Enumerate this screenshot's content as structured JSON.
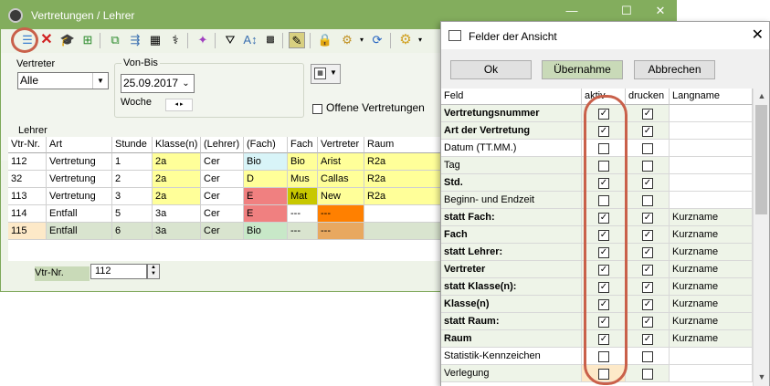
{
  "main_window": {
    "title": "Vertretungen / Lehrer",
    "controls": {
      "minimize": "—",
      "maximize": "☐",
      "close": "✕"
    }
  },
  "toolbar": {
    "icons": [
      "list-view-icon",
      "delete-x-icon",
      "graduation-cap-icon",
      "add-record-icon",
      "copy-doc-icon",
      "export-doc-icon",
      "calculator-icon",
      "stethoscope-icon",
      "magic-wand-icon",
      "filter-icon",
      "sort-az-icon",
      "grid-select-icon",
      "edit-notepad-icon",
      "lock-icon",
      "settings-doc-icon",
      "refresh-icon",
      "gear-icon"
    ]
  },
  "filters": {
    "vertreter_label": "Vertreter",
    "vertreter_value": "Alle",
    "vonbis_label": "Von-Bis",
    "date_value": "25.09.2017",
    "woche_label": "Woche",
    "offene_label": "Offene Vertretungen",
    "lehrer_label": "Lehrer"
  },
  "table": {
    "columns": [
      "Vtr-Nr.",
      "Art",
      "Stunde",
      "Klasse(n)",
      "(Lehrer)",
      "(Fach)",
      "Fach",
      "Vertreter",
      "Raum"
    ],
    "rows": [
      {
        "nr": "112",
        "art": "Vertretung",
        "stunde": "1",
        "klasse": "2a",
        "lehrer": "Cer",
        "sfach": "Bio",
        "fach": "Bio",
        "vertreter": "Arist",
        "raum": "R2a"
      },
      {
        "nr": "32",
        "art": "Vertretung",
        "stunde": "2",
        "klasse": "2a",
        "lehrer": "Cer",
        "sfach": "D",
        "fach": "Mus",
        "vertreter": "Callas",
        "raum": "R2a"
      },
      {
        "nr": "113",
        "art": "Vertretung",
        "stunde": "3",
        "klasse": "2a",
        "lehrer": "Cer",
        "sfach": "E",
        "fach": "Mat",
        "vertreter": "New",
        "raum": "R2a"
      },
      {
        "nr": "114",
        "art": "Entfall",
        "stunde": "5",
        "klasse": "3a",
        "lehrer": "Cer",
        "sfach": "E",
        "fach": "---",
        "vertreter": "---",
        "raum": ""
      },
      {
        "nr": "115",
        "art": "Entfall",
        "stunde": "6",
        "klasse": "3a",
        "lehrer": "Cer",
        "sfach": "Bio",
        "fach": "---",
        "vertreter": "---",
        "raum": ""
      }
    ]
  },
  "bottom": {
    "vtr_label": "Vtr-Nr.",
    "vtr_value": "112"
  },
  "dialog": {
    "title": "Felder der Ansicht",
    "ok_label": "Ok",
    "uebernahme_label": "Übernahme",
    "abbrechen_label": "Abbrechen",
    "columns": [
      "Feld",
      "aktiv",
      "drucken",
      "Langname"
    ],
    "rows": [
      {
        "feld": "Vertretungsnummer",
        "bold": true,
        "aktiv": true,
        "drucken": true,
        "langname": ""
      },
      {
        "feld": "Art der Vertretung",
        "bold": true,
        "aktiv": true,
        "drucken": true,
        "langname": ""
      },
      {
        "feld": "Datum (TT.MM.)",
        "bold": false,
        "aktiv": false,
        "drucken": false,
        "langname": ""
      },
      {
        "feld": "Tag",
        "bold": false,
        "aktiv": false,
        "drucken": false,
        "langname": ""
      },
      {
        "feld": "Std.",
        "bold": true,
        "aktiv": true,
        "drucken": true,
        "langname": ""
      },
      {
        "feld": "Beginn- und Endzeit",
        "bold": false,
        "aktiv": false,
        "drucken": false,
        "langname": ""
      },
      {
        "feld": "statt Fach:",
        "bold": true,
        "aktiv": true,
        "drucken": true,
        "langname": "Kurzname"
      },
      {
        "feld": "Fach",
        "bold": true,
        "aktiv": true,
        "drucken": true,
        "langname": "Kurzname"
      },
      {
        "feld": "statt Lehrer:",
        "bold": true,
        "aktiv": true,
        "drucken": true,
        "langname": "Kurzname"
      },
      {
        "feld": "Vertreter",
        "bold": true,
        "aktiv": true,
        "drucken": true,
        "langname": "Kurzname"
      },
      {
        "feld": "statt Klasse(n):",
        "bold": true,
        "aktiv": true,
        "drucken": true,
        "langname": "Kurzname"
      },
      {
        "feld": "Klasse(n)",
        "bold": true,
        "aktiv": true,
        "drucken": true,
        "langname": "Kurzname"
      },
      {
        "feld": "statt Raum:",
        "bold": true,
        "aktiv": true,
        "drucken": true,
        "langname": "Kurzname"
      },
      {
        "feld": "Raum",
        "bold": true,
        "aktiv": true,
        "drucken": true,
        "langname": "Kurzname"
      },
      {
        "feld": "Statistik-Kennzeichen",
        "bold": false,
        "aktiv": false,
        "drucken": false,
        "langname": ""
      },
      {
        "feld": "Verlegung",
        "bold": false,
        "aktiv": false,
        "drucken": false,
        "langname": ""
      }
    ]
  },
  "colors": {
    "titlebar": "#83ad5d",
    "highlight_circle": "#c9604a",
    "row_yellow": "#ffff99",
    "cell_pink": "#f08080",
    "cell_orange": "#ff8000",
    "cell_olive": "#c8c800",
    "selected_row": "#d9e4cf"
  }
}
